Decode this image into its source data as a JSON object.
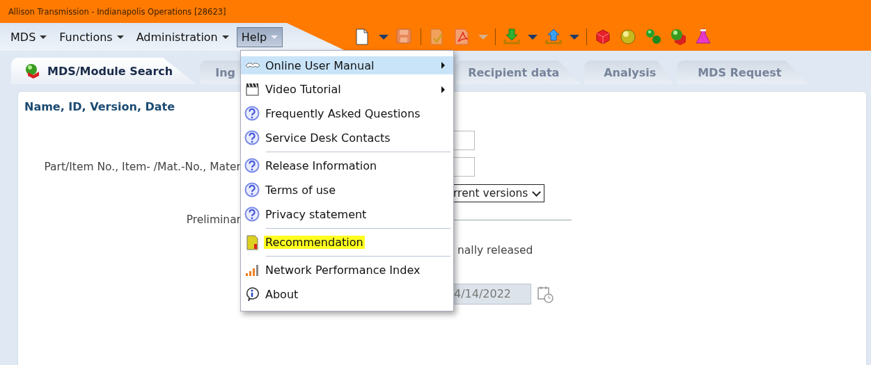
{
  "window": {
    "title": "Allison Transmission - Indianapolis Operations [28623]"
  },
  "menu_bar": [
    {
      "label": "MDS",
      "selected": false
    },
    {
      "label": "Functions",
      "selected": false
    },
    {
      "label": "Administration",
      "selected": false
    },
    {
      "label": "Help",
      "selected": true
    }
  ],
  "tabs": [
    {
      "label": "MDS/Module Search",
      "selected": true
    },
    {
      "label": "Ing",
      "selected": false
    },
    {
      "label": "Recipient data",
      "selected": false
    },
    {
      "label": "Analysis",
      "selected": false
    },
    {
      "label": "MDS Request",
      "selected": false
    }
  ],
  "panel": {
    "heading": "Name, ID, Version, Date",
    "rows": [
      {
        "kind": "input"
      },
      {
        "kind": "input",
        "label": "Part/Item No., Item- /Mat.-No., Mater"
      },
      {
        "kind": "select",
        "value": "rrent versions"
      },
      {
        "kind": "line",
        "label": "Preliminar"
      },
      {
        "kind": "text",
        "text": "nally released"
      },
      {
        "kind": "date",
        "value": "4/14/2022"
      }
    ]
  },
  "help_menu": {
    "groups": [
      [
        {
          "label": "Online User Manual",
          "submenu": true,
          "selected": true,
          "highlighted": false
        },
        {
          "label": "Video Tutorial",
          "submenu": true,
          "selected": false,
          "highlighted": false
        },
        {
          "label": "Frequently Asked Questions",
          "submenu": false,
          "selected": false,
          "highlighted": false
        },
        {
          "label": "Service Desk Contacts",
          "submenu": false,
          "selected": false,
          "highlighted": false
        }
      ],
      [
        {
          "label": "Release Information",
          "submenu": false,
          "selected": false,
          "highlighted": false
        },
        {
          "label": "Terms of use",
          "submenu": false,
          "selected": false,
          "highlighted": false
        },
        {
          "label": "Privacy statement",
          "submenu": false,
          "selected": false,
          "highlighted": false
        }
      ],
      [
        {
          "label": "Recommendation",
          "submenu": false,
          "selected": false,
          "highlighted": true
        }
      ],
      [
        {
          "label": "Network Performance Index",
          "submenu": false,
          "selected": false,
          "highlighted": false
        },
        {
          "label": "About",
          "submenu": false,
          "selected": false,
          "highlighted": false
        }
      ]
    ]
  }
}
